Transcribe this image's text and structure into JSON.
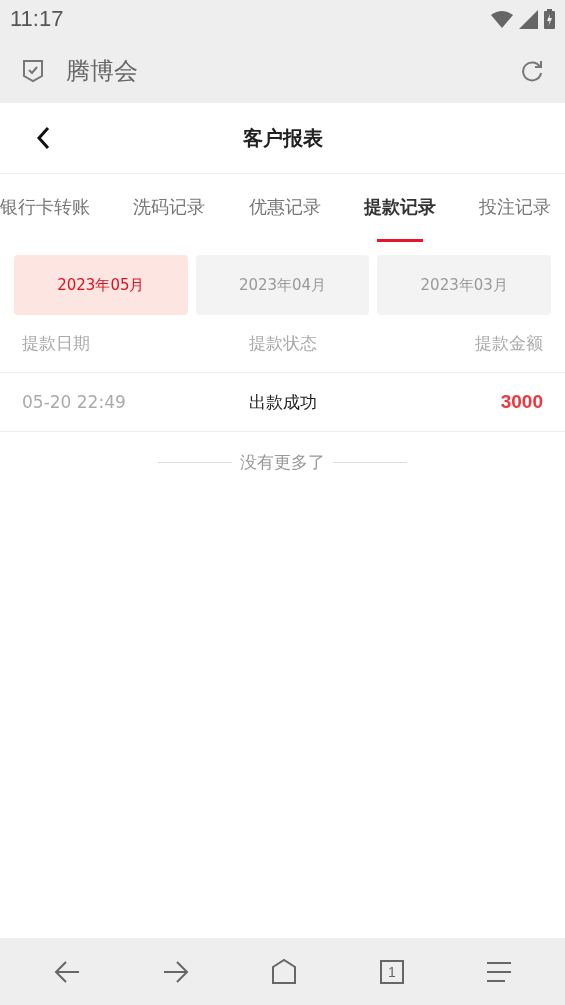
{
  "status_bar": {
    "time": "11:17"
  },
  "browser_bar": {
    "title": "腾博会"
  },
  "header": {
    "title": "客户报表"
  },
  "tabs": [
    {
      "label": "银行卡转账",
      "selected": false
    },
    {
      "label": "洗码记录",
      "selected": false
    },
    {
      "label": "优惠记录",
      "selected": false
    },
    {
      "label": "提款记录",
      "selected": true
    },
    {
      "label": "投注记录",
      "selected": false
    }
  ],
  "months": [
    {
      "label": "2023年05月",
      "selected": true
    },
    {
      "label": "2023年04月",
      "selected": false
    },
    {
      "label": "2023年03月",
      "selected": false
    }
  ],
  "table": {
    "columns": [
      "提款日期",
      "提款状态",
      "提款金额"
    ],
    "rows": [
      [
        "05-20 22:49",
        "出款成功",
        "3000"
      ]
    ]
  },
  "end_note": "没有更多了",
  "nav_bar": {
    "tab_count": "1"
  }
}
